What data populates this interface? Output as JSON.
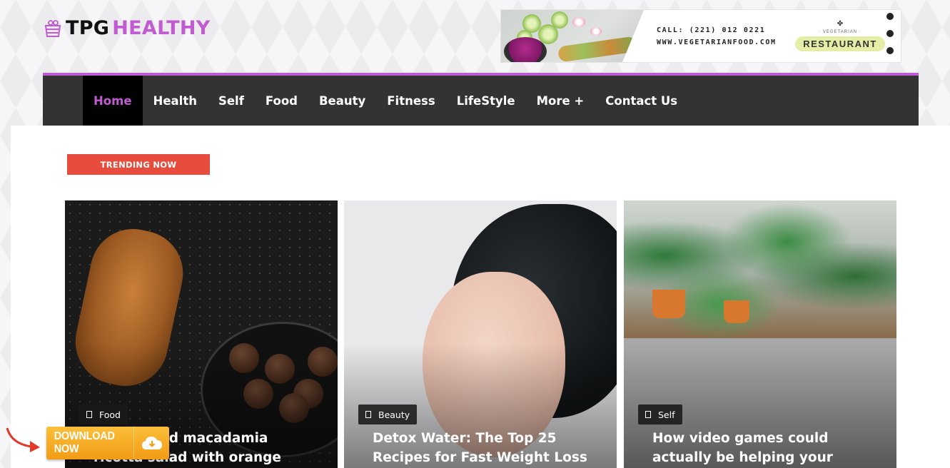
{
  "brand": {
    "part1": "TPG",
    "part2": "HEALTHY",
    "accent": "#c05bd2"
  },
  "banner": {
    "call": "CALL: (221) 012 0221",
    "url": "WWW.VEGETARIANFOOD.COM",
    "badge_top": "· VEGETARIAN ·",
    "badge_main": "RESTAURANT"
  },
  "nav": {
    "items": [
      {
        "label": "Home",
        "active": true
      },
      {
        "label": "Health"
      },
      {
        "label": "Self"
      },
      {
        "label": "Food"
      },
      {
        "label": "Beauty"
      },
      {
        "label": "Fitness"
      },
      {
        "label": "LifeStyle"
      },
      {
        "label": "More +"
      },
      {
        "label": "Contact Us"
      }
    ]
  },
  "trending": {
    "label": "TRENDING NOW",
    "color": "#e74c3c"
  },
  "cards": [
    {
      "category": "Food",
      "title": "Quinoa and macadamia ricotta salad with orange"
    },
    {
      "category": "Beauty",
      "title": "Detox Water: The Top 25 Recipes for Fast Weight Loss"
    },
    {
      "category": "Self",
      "title": "How video games could actually be helping your mental health"
    }
  ],
  "download": {
    "label": "DOWNLOAD NOW",
    "color": "#f29b15"
  }
}
